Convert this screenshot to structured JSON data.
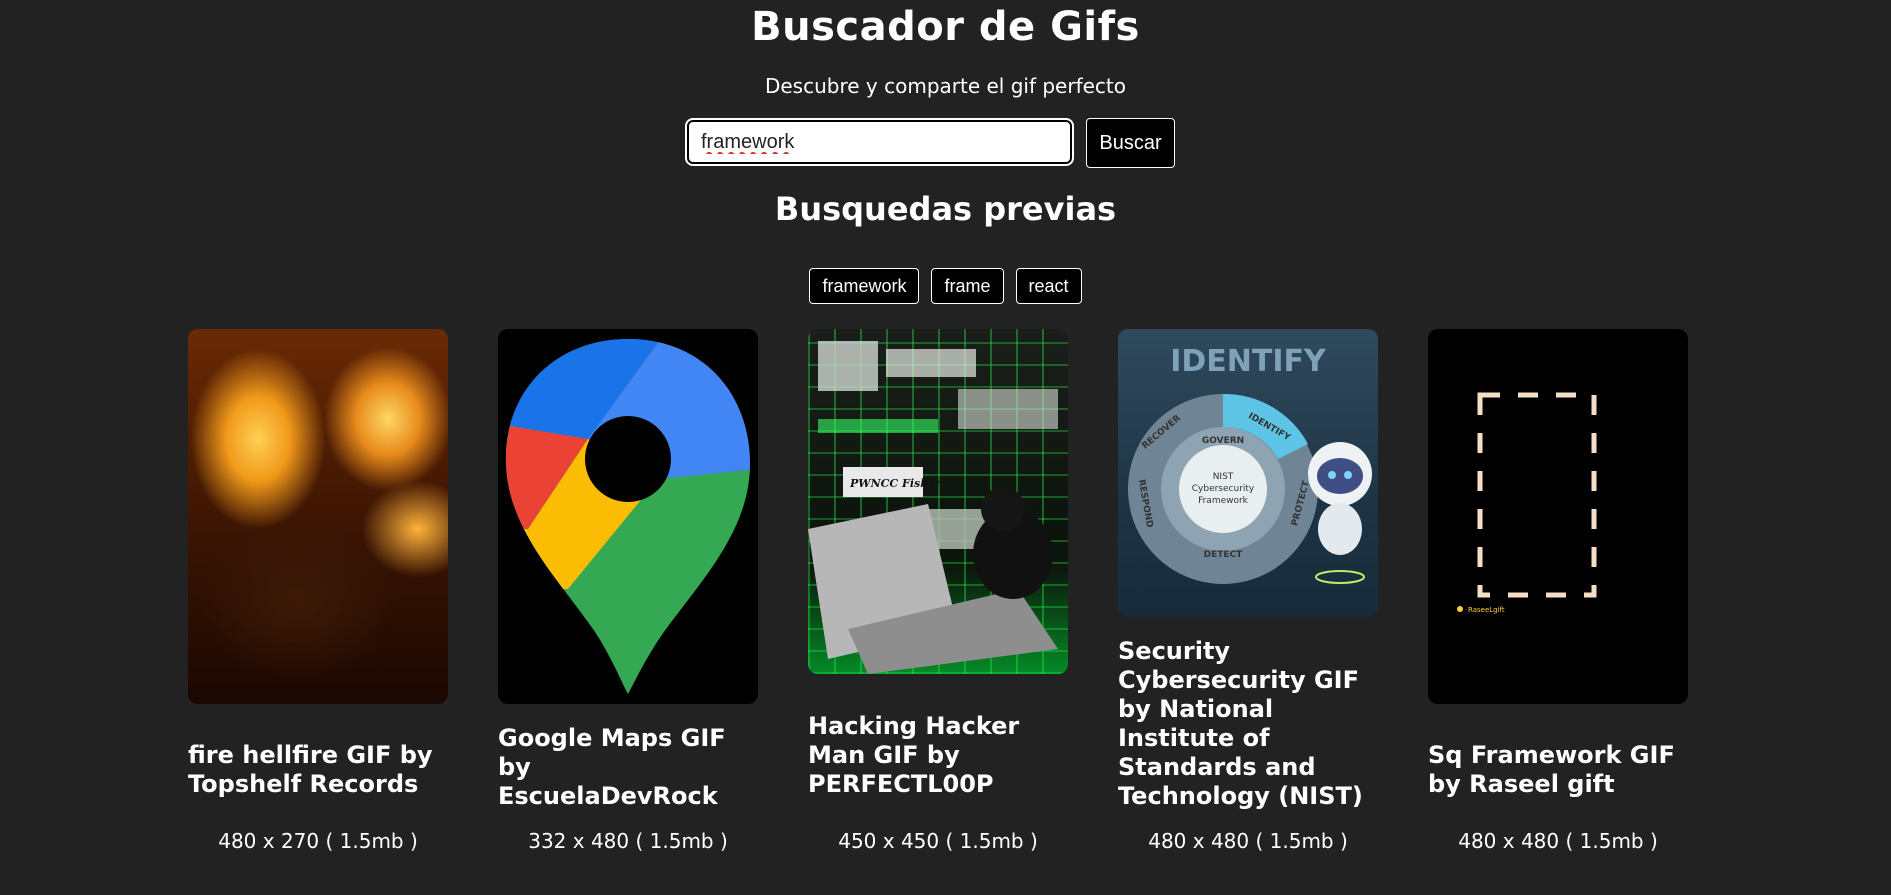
{
  "header": {
    "title": "Buscador de Gifs",
    "subtitle": "Descubre y comparte el gif perfecto"
  },
  "search": {
    "value": "framework",
    "button_label": "Buscar"
  },
  "previous_searches": {
    "title": "Busquedas previas",
    "items": [
      "framework",
      "frame",
      "react"
    ]
  },
  "gifs": [
    {
      "title": "fire hellfire GIF by Topshelf Records",
      "meta": "480 x 270 ( 1.5mb )",
      "thumb_icon": "fire-image"
    },
    {
      "title": "Google Maps GIF by EscuelaDevRock",
      "meta": "332 x 480 ( 1.5mb )",
      "thumb_icon": "google-maps-pin-image"
    },
    {
      "title": "Hacking Hacker Man GIF by PERFECTL00P",
      "meta": "450 x 450 ( 1.5mb )",
      "thumb_icon": "hacker-cat-image",
      "thumb_text": "PWNCC Fisher"
    },
    {
      "title": "Security Cybersecurity GIF by National Institute of Standards and Technology (NIST)",
      "meta": "480 x 480 ( 1.5mb )",
      "thumb_icon": "nist-framework-image",
      "thumb_heading": "IDENTIFY",
      "thumb_center": [
        "NIST",
        "Cybersecurity",
        "Framework"
      ],
      "thumb_ring": [
        "GOVERN",
        "IDENTIFY",
        "PROTECT",
        "DETECT",
        "RESPOND",
        "RECOVER"
      ]
    },
    {
      "title": "Sq Framework GIF by Raseel gift",
      "meta": "480 x 480 ( 1.5mb )",
      "thumb_icon": "dashed-frame-image",
      "thumb_watermark": "RaseeLgift"
    }
  ],
  "colors": {
    "background": "#222222",
    "text": "#ffffff",
    "button_bg": "#000000"
  }
}
